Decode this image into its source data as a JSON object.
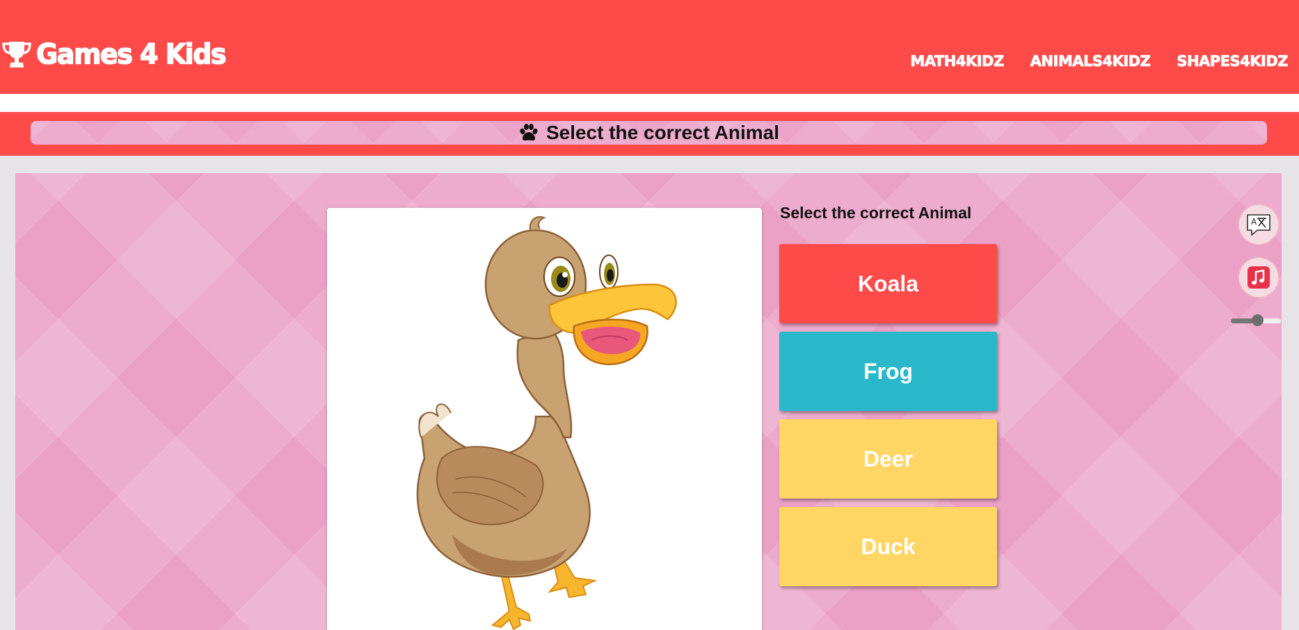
{
  "header": {
    "brand": "Games 4 Kids",
    "nav": [
      "MATH4KIDZ",
      "ANIMALS4KIDZ",
      "SHAPES4KIDZ"
    ]
  },
  "title_bar": {
    "text": "Select the correct Animal",
    "icon": "paw-icon"
  },
  "question": {
    "prompt": "Select the correct Animal",
    "image": "duck-illustration"
  },
  "answers": [
    {
      "label": "Koala",
      "color": "#ff4a4a"
    },
    {
      "label": "Frog",
      "color": "#29b8ca"
    },
    {
      "label": "Deer",
      "color": "#ffd563"
    },
    {
      "label": "Duck",
      "color": "#ffd563"
    }
  ],
  "controls": {
    "translate_icon": "translate-icon",
    "music_icon": "music-note-icon",
    "volume": 0.55
  },
  "colors": {
    "header": "#ff4a4a",
    "stage": "#eba0c6"
  }
}
